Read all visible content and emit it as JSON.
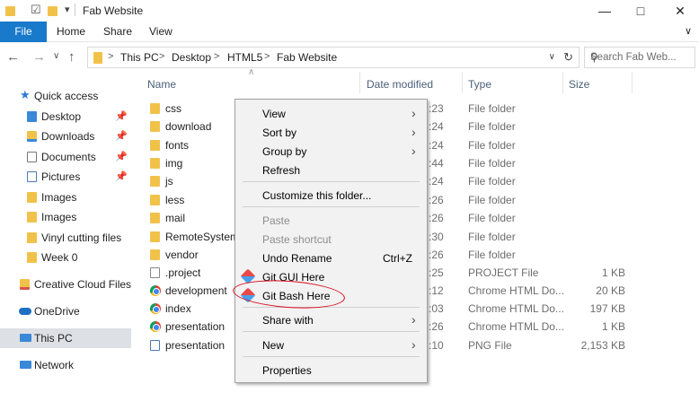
{
  "window": {
    "title": "Fab Website",
    "quick_access_dropdown": "▾",
    "minimize": "—",
    "maximize": "□",
    "close": "✕"
  },
  "ribbon": {
    "file": "File",
    "tabs": [
      "Home",
      "Share",
      "View"
    ],
    "expand": "∨"
  },
  "address": {
    "crumbs": [
      "This PC",
      "Desktop",
      "HTML5",
      "Fab Website"
    ],
    "separator": ">",
    "search_placeholder": "Search Fab Web..."
  },
  "nav_pane": {
    "quick_access": "Quick access",
    "items": [
      {
        "label": "Desktop",
        "pinned": true
      },
      {
        "label": "Downloads",
        "pinned": true
      },
      {
        "label": "Documents",
        "pinned": true
      },
      {
        "label": "Pictures",
        "pinned": true
      },
      {
        "label": "Images",
        "pinned": false
      },
      {
        "label": "Images",
        "pinned": false
      },
      {
        "label": "Vinyl cutting files",
        "pinned": false
      },
      {
        "label": "Week 0",
        "pinned": false
      }
    ],
    "creative_cloud": "Creative Cloud Files",
    "onedrive": "OneDrive",
    "this_pc": "This PC",
    "network": "Network"
  },
  "columns": {
    "name": "Name",
    "date": "Date modified",
    "type": "Type",
    "size": "Size"
  },
  "files": [
    {
      "name": "css",
      "date": ":23",
      "type": "File folder",
      "size": "",
      "icon": "folder"
    },
    {
      "name": "download",
      "date": ":24",
      "type": "File folder",
      "size": "",
      "icon": "folder"
    },
    {
      "name": "fonts",
      "date": ":24",
      "type": "File folder",
      "size": "",
      "icon": "folder"
    },
    {
      "name": "img",
      "date": ":44",
      "type": "File folder",
      "size": "",
      "icon": "folder"
    },
    {
      "name": "js",
      "date": ":24",
      "type": "File folder",
      "size": "",
      "icon": "folder"
    },
    {
      "name": "less",
      "date": ":26",
      "type": "File folder",
      "size": "",
      "icon": "folder"
    },
    {
      "name": "mail",
      "date": ":26",
      "type": "File folder",
      "size": "",
      "icon": "folder"
    },
    {
      "name": "RemoteSystems",
      "date": ":30",
      "type": "File folder",
      "size": "",
      "icon": "folder"
    },
    {
      "name": "vendor",
      "date": ":26",
      "type": "File folder",
      "size": "",
      "icon": "folder"
    },
    {
      "name": ".project",
      "date": ":25",
      "type": "PROJECT File",
      "size": "1 KB",
      "icon": "doc"
    },
    {
      "name": "development",
      "date": ":12",
      "type": "Chrome HTML Do...",
      "size": "20 KB",
      "icon": "chrome"
    },
    {
      "name": "index",
      "date": ":03",
      "type": "Chrome HTML Do...",
      "size": "197 KB",
      "icon": "chrome"
    },
    {
      "name": "presentation",
      "date": ":26",
      "type": "Chrome HTML Do...",
      "size": "1 KB",
      "icon": "chrome"
    },
    {
      "name": "presentation",
      "date": ":10",
      "type": "PNG File",
      "size": "2,153 KB",
      "icon": "png"
    }
  ],
  "context_menu": {
    "view": "View",
    "sort_by": "Sort by",
    "group_by": "Group by",
    "refresh": "Refresh",
    "customize": "Customize this folder...",
    "paste": "Paste",
    "paste_shortcut": "Paste shortcut",
    "undo_rename": "Undo Rename",
    "undo_shortcut": "Ctrl+Z",
    "git_gui": "Git GUI Here",
    "git_bash": "Git Bash Here",
    "share_with": "Share with",
    "new": "New",
    "properties": "Properties"
  },
  "accent_color": "#1979ca",
  "annotation_color": "#d8101e"
}
